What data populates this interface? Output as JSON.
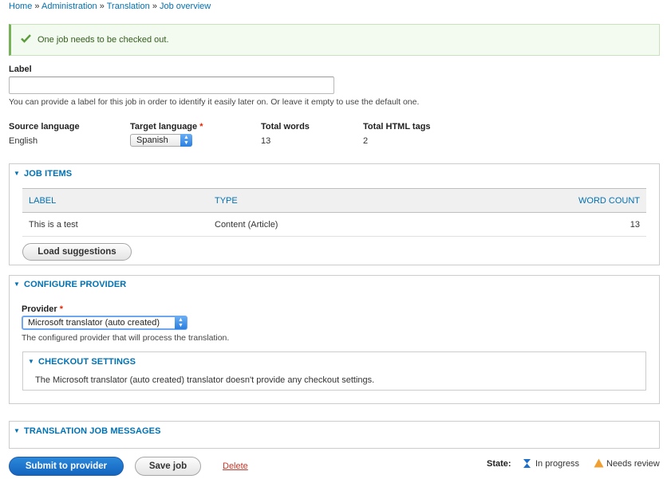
{
  "breadcrumb": {
    "items": [
      "Home",
      "Administration",
      "Translation",
      "Job overview"
    ],
    "separator": "»"
  },
  "status": {
    "message": "One job needs to be checked out."
  },
  "label_field": {
    "title": "Label",
    "value": "",
    "description": "You can provide a label for this job in order to identify it easily later on. Or leave it empty to use the default one."
  },
  "info": {
    "source_language_label": "Source language",
    "source_language_value": "English",
    "target_language_label": "Target language",
    "target_language_value": "Spanish",
    "total_words_label": "Total words",
    "total_words_value": "13",
    "total_html_label": "Total HTML tags",
    "total_html_value": "2",
    "required_marker": "*"
  },
  "job_items": {
    "legend": "JOB ITEMS",
    "columns": [
      "LABEL",
      "TYPE",
      "WORD COUNT"
    ],
    "rows": [
      {
        "label": "This is a test",
        "type": "Content (Article)",
        "word_count": "13"
      }
    ],
    "load_suggestions_label": "Load suggestions"
  },
  "configure_provider": {
    "legend": "CONFIGURE PROVIDER",
    "provider_label": "Provider",
    "provider_value": "Microsoft translator (auto created)",
    "provider_description": "The configured provider that will process the translation.",
    "checkout": {
      "legend": "CHECKOUT SETTINGS",
      "text": "The Microsoft translator (auto created) translator doesn't provide any checkout settings."
    }
  },
  "messages": {
    "legend": "TRANSLATION JOB MESSAGES"
  },
  "actions": {
    "submit_label": "Submit to provider",
    "save_label": "Save job",
    "delete_label": "Delete"
  },
  "state_legend": {
    "label": "State:",
    "in_progress": "In progress",
    "needs_review": "Needs review"
  },
  "colors": {
    "link": "#0071b3",
    "primary_button": "#1a6fcc",
    "success_border": "#77b259",
    "required": "#e62600",
    "needs_review_icon": "#f0a030",
    "in_progress_icon": "#1a6fcc",
    "delete_link": "#c0392b"
  }
}
